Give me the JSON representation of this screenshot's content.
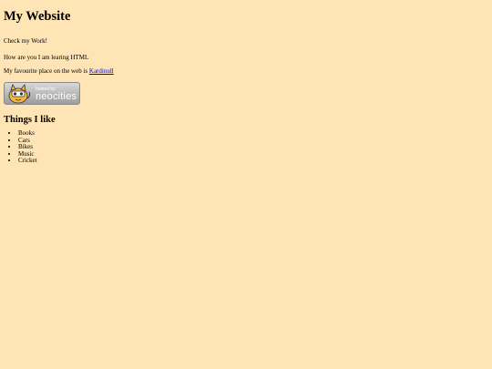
{
  "page": {
    "title": "My Website",
    "intro": "Check my Work!",
    "question": "How are you I am learing HTML",
    "favourite_prefix": "My favourite place on the web is ",
    "favourite_link": "Kardinull"
  },
  "badge": {
    "hosted_label": "hosted by",
    "brand_label": "neocities",
    "icon": "neocities-cat-icon"
  },
  "likes": {
    "heading": "Things I like",
    "items": [
      "Books",
      "Cars",
      "Bikes",
      "Music",
      "Cricket"
    ]
  },
  "colors": {
    "background": "#ffe4b5",
    "link": "#0000ee"
  }
}
